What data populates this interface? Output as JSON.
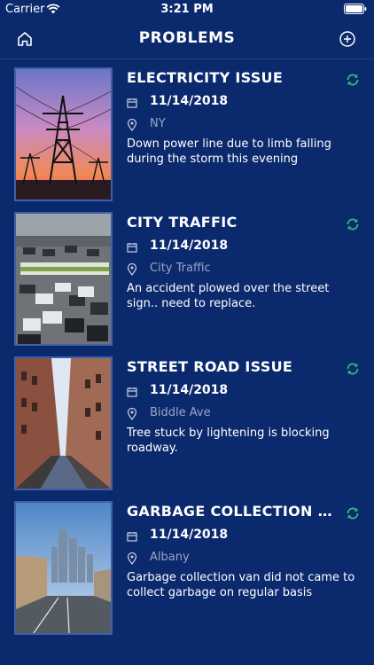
{
  "status_bar": {
    "carrier": "Carrier",
    "time": "3:21 PM"
  },
  "nav": {
    "title": "PROBLEMS",
    "left_icon": "home-icon",
    "right_icon": "add-circle-icon"
  },
  "colors": {
    "background": "#0b2a6e",
    "accent_green": "#2fbf71",
    "muted_text": "#9aa6c4"
  },
  "problems": [
    {
      "title": "ELECTRICITY ISSUE",
      "date": "11/14/2018",
      "location": "NY",
      "description": "Down power line due to limb falling during the storm this evening",
      "status_icon": "sync-icon"
    },
    {
      "title": "CITY TRAFFIC",
      "date": "11/14/2018",
      "location": "City Traffic",
      "description": "An accident plowed over the street sign.. need to replace.",
      "status_icon": "sync-icon"
    },
    {
      "title": "STREET ROAD ISSUE",
      "date": "11/14/2018",
      "location": "Biddle Ave",
      "description": "Tree stuck by lightening is blocking roadway.",
      "status_icon": "sync-icon"
    },
    {
      "title": "GARBAGE COLLECTION I...",
      "date": "11/14/2018",
      "location": "Albany",
      "description": "Garbage collection van did not came to collect garbage on regular basis",
      "status_icon": "sync-icon"
    }
  ]
}
